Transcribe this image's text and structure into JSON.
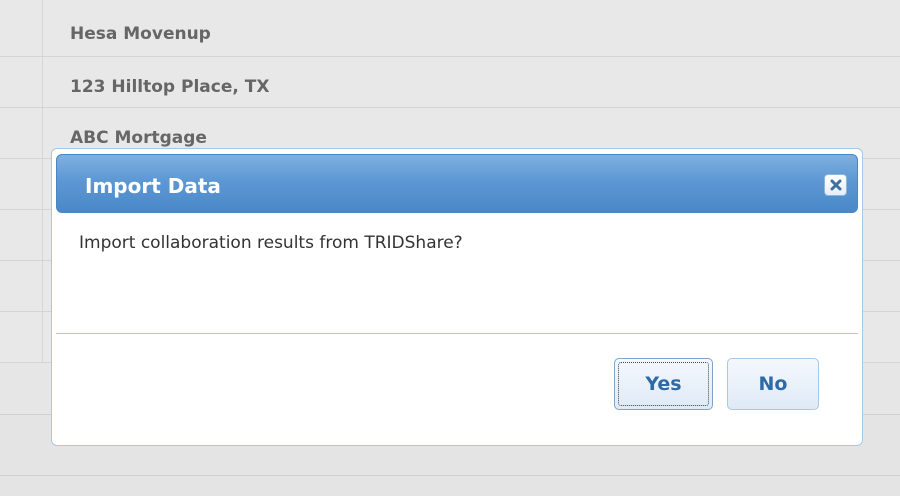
{
  "background": {
    "rows": [
      {
        "text": "Hesa Movenup"
      },
      {
        "text": "123 Hilltop Place, TX"
      },
      {
        "text": "ABC Mortgage"
      },
      {
        "text": ""
      },
      {
        "text": ""
      },
      {
        "text": ""
      },
      {
        "text": ""
      },
      {
        "text": ""
      }
    ]
  },
  "dialog": {
    "title": "Import Data",
    "message": "Import collaboration results from TRIDShare?",
    "yes_label": "Yes",
    "no_label": "No",
    "close_icon": "close-icon"
  },
  "colors": {
    "header_gradient_top": "#7fb0e0",
    "header_gradient_bottom": "#4a88c8",
    "button_text": "#2e6aa5",
    "background": "#e8e8e8"
  }
}
